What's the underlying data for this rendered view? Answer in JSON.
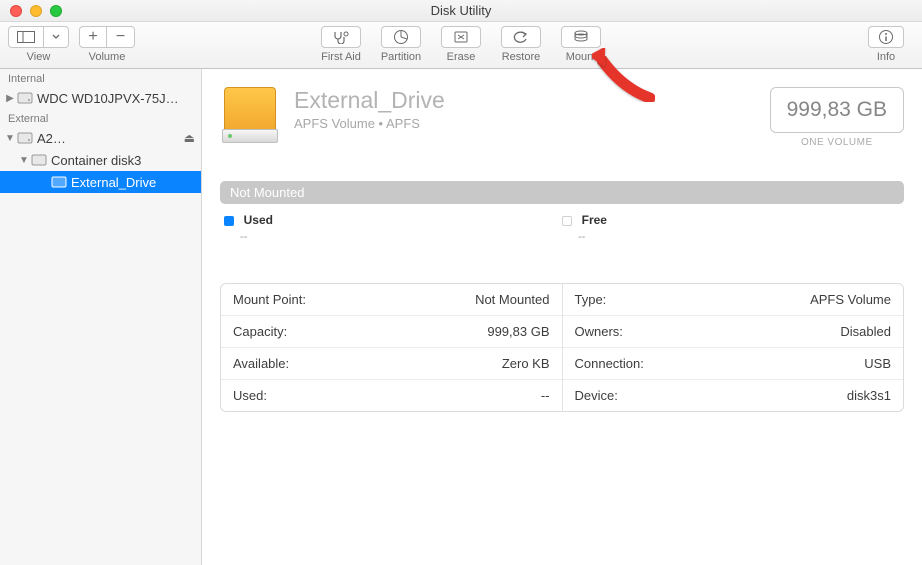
{
  "window_title": "Disk Utility",
  "toolbar": {
    "view_label": "View",
    "volume_label": "Volume",
    "first_aid": "First Aid",
    "partition": "Partition",
    "erase": "Erase",
    "restore": "Restore",
    "mount": "Mount",
    "info": "Info"
  },
  "sidebar": {
    "internal_label": "Internal",
    "internal_disk": "WDC WD10JPVX-75J…",
    "external_label": "External",
    "external_disk": "A2…",
    "container": "Container disk3",
    "volume": "External_Drive",
    "eject_glyph": "⏏"
  },
  "header": {
    "name": "External_Drive",
    "subtitle": "APFS Volume • APFS",
    "size": "999,83 GB",
    "size_sub": "ONE VOLUME"
  },
  "status_bar": "Not Mounted",
  "legend": {
    "used_label": "Used",
    "used_value": "--",
    "free_label": "Free",
    "free_value": "--"
  },
  "details": {
    "left": [
      {
        "k": "Mount Point:",
        "v": "Not Mounted"
      },
      {
        "k": "Capacity:",
        "v": "999,83 GB"
      },
      {
        "k": "Available:",
        "v": "Zero KB"
      },
      {
        "k": "Used:",
        "v": "--"
      }
    ],
    "right": [
      {
        "k": "Type:",
        "v": "APFS Volume"
      },
      {
        "k": "Owners:",
        "v": "Disabled"
      },
      {
        "k": "Connection:",
        "v": "USB"
      },
      {
        "k": "Device:",
        "v": "disk3s1"
      }
    ]
  }
}
